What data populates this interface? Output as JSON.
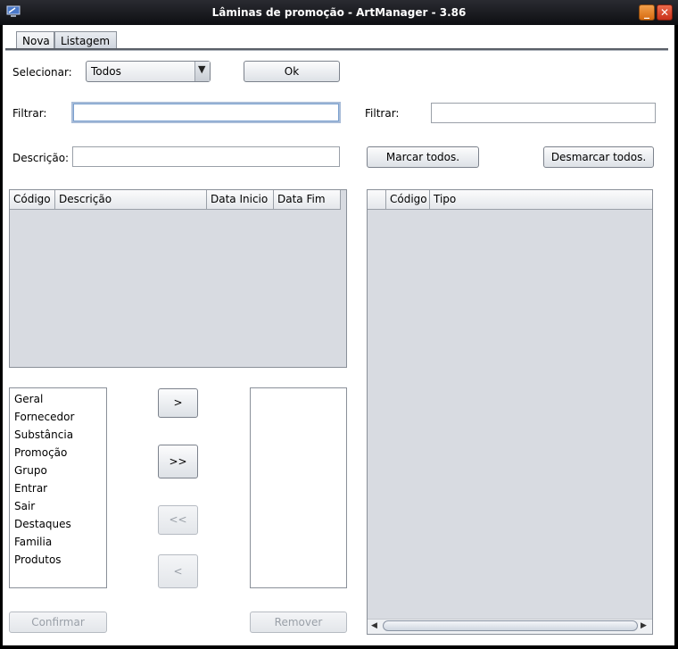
{
  "window": {
    "title": "Lâminas de promoção - ArtManager - 3.86",
    "minimize_label": "_",
    "close_label": "✕"
  },
  "tabs": [
    {
      "label": "Nova"
    },
    {
      "label": "Listagem"
    }
  ],
  "select": {
    "label": "Selecionar:",
    "value": "Todos",
    "ok_label": "Ok"
  },
  "left": {
    "filter_label": "Filtrar:",
    "filter_value": "",
    "description_label": "Descrição:",
    "description_value": "",
    "table_headers": [
      "Código",
      "Descrição",
      "Data Inicio",
      "Data Fim"
    ]
  },
  "right": {
    "filter_label": "Filtrar:",
    "filter_value": "",
    "mark_all_label": "Marcar todos.",
    "unmark_all_label": "Desmarcar todos.",
    "table_headers": [
      "",
      "Código",
      "Tipo"
    ]
  },
  "available_items": [
    "Geral",
    "Fornecedor",
    "Substância",
    "Promoção",
    "Grupo",
    "Entrar",
    "Sair",
    "Destaques",
    "Familia",
    "Produtos"
  ],
  "transfer": {
    "add_label": ">",
    "add_all_label": ">>",
    "remove_all_label": "<<",
    "remove_label": "<"
  },
  "footer": {
    "confirm_label": "Confirmar",
    "remove_label": "Remover"
  },
  "colors": {
    "titlebar": "#0d0e12",
    "table_background": "#d8dbe1",
    "focus_border": "#7aa0cf"
  }
}
